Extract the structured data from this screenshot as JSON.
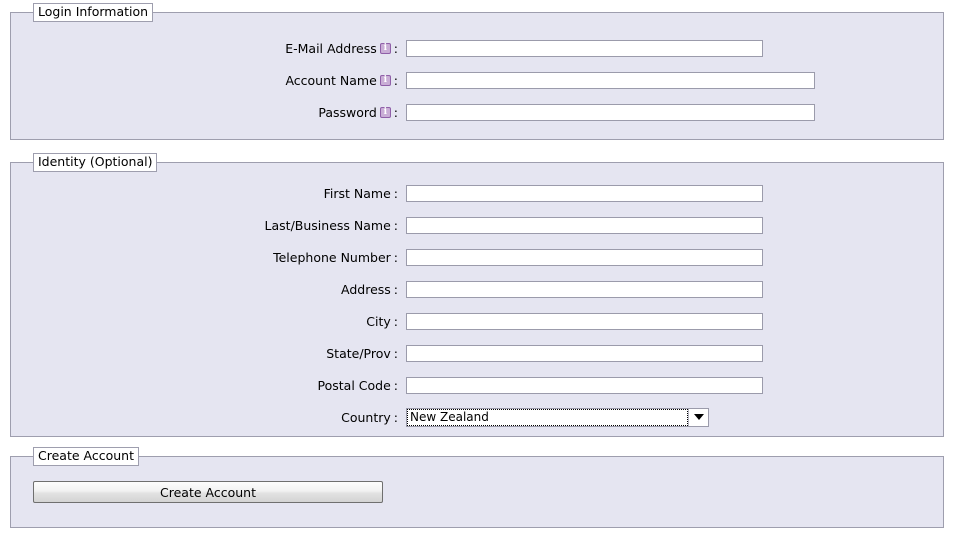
{
  "sections": {
    "login": {
      "legend": "Login Information",
      "fields": [
        {
          "label": "E-Mail Address",
          "has_info_icon": true,
          "value": "",
          "width_class": "w-355"
        },
        {
          "label": "Account Name",
          "has_info_icon": true,
          "value": "",
          "width_class": "w-408"
        },
        {
          "label": "Password",
          "has_info_icon": true,
          "value": "",
          "width_class": "w-408"
        }
      ]
    },
    "identity": {
      "legend": "Identity (Optional)",
      "fields": [
        {
          "label": "First Name",
          "value": "",
          "width_class": "w-355"
        },
        {
          "label": "Last/Business Name",
          "value": "",
          "width_class": "w-355"
        },
        {
          "label": "Telephone Number",
          "value": "",
          "width_class": "w-355"
        },
        {
          "label": "Address",
          "value": "",
          "width_class": "w-355"
        },
        {
          "label": "City",
          "value": "",
          "width_class": "w-355"
        },
        {
          "label": "State/Prov",
          "value": "",
          "width_class": "w-355"
        },
        {
          "label": "Postal Code",
          "value": "",
          "width_class": "w-355"
        }
      ],
      "country": {
        "label": "Country",
        "selected": "New Zealand"
      }
    },
    "create": {
      "legend": "Create Account",
      "button_label": "Create Account"
    }
  },
  "colors": {
    "panel_background": "#e5e5f1",
    "panel_border": "#9e9eae",
    "page_background": "#ffffff",
    "info_icon": "#8f5fa8",
    "input_background": "#ffffff",
    "input_border": "#9b9bab"
  },
  "icons": {
    "info": "info-icon",
    "dropdown": "chevron-down-icon"
  },
  "colon": ":"
}
